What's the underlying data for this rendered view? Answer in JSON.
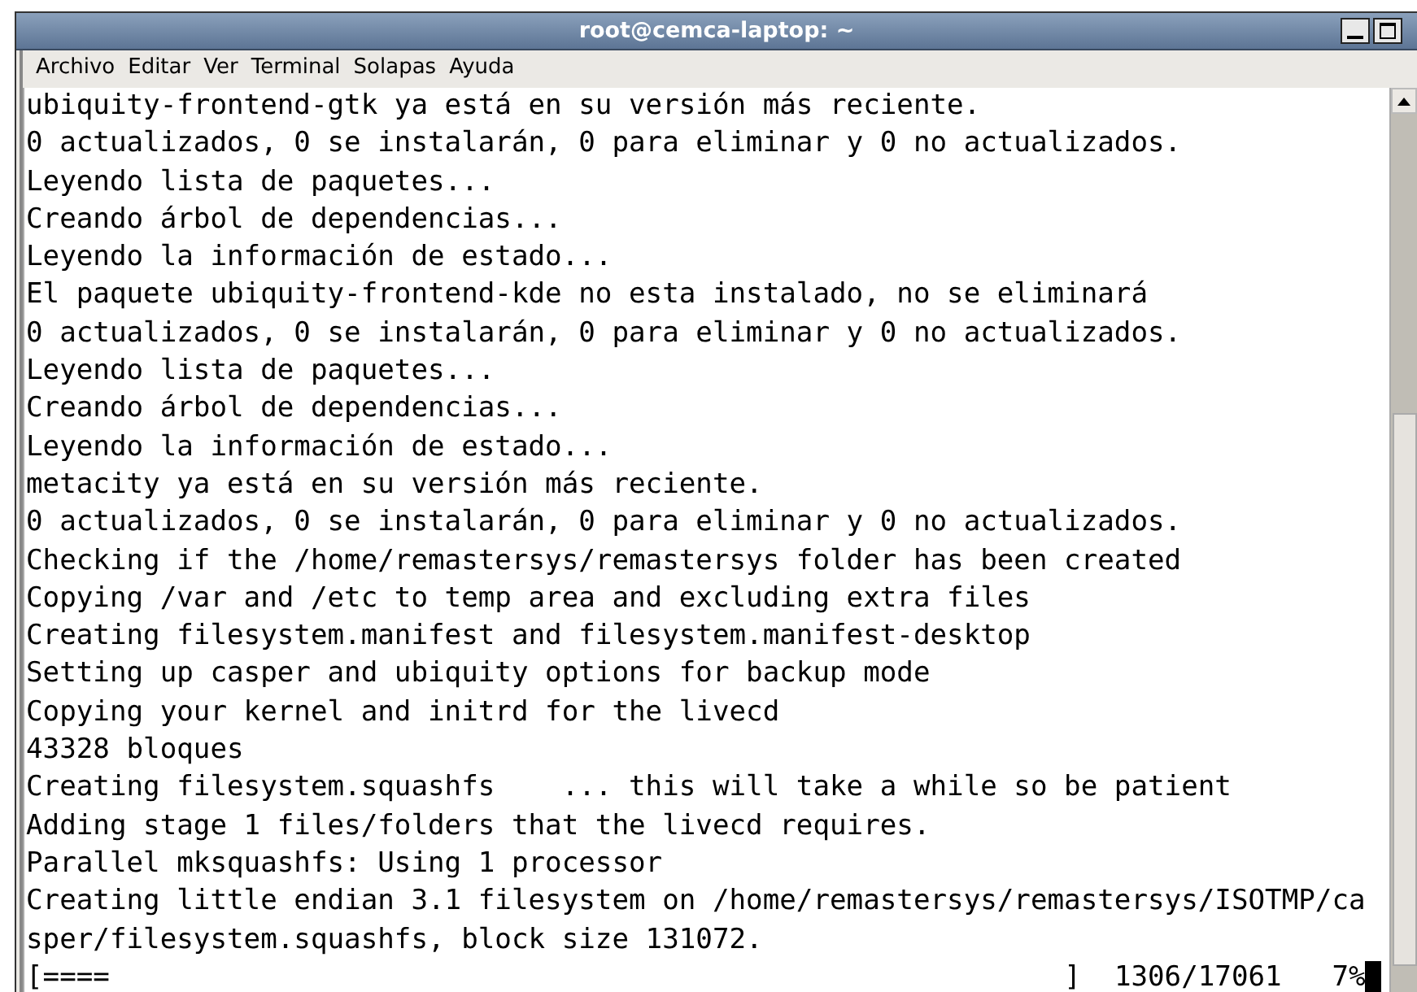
{
  "window": {
    "title": "root@cemca-laptop: ~"
  },
  "menu": [
    "Archivo",
    "Editar",
    "Ver",
    "Terminal",
    "Solapas",
    "Ayuda"
  ],
  "terminal": {
    "lines": [
      "ubiquity-frontend-gtk ya está en su versión más reciente.",
      "0 actualizados, 0 se instalarán, 0 para eliminar y 0 no actualizados.",
      "Leyendo lista de paquetes...",
      "Creando árbol de dependencias...",
      "Leyendo la información de estado...",
      "El paquete ubiquity-frontend-kde no esta instalado, no se eliminará",
      "0 actualizados, 0 se instalarán, 0 para eliminar y 0 no actualizados.",
      "Leyendo lista de paquetes...",
      "Creando árbol de dependencias...",
      "Leyendo la información de estado...",
      "metacity ya está en su versión más reciente.",
      "0 actualizados, 0 se instalarán, 0 para eliminar y 0 no actualizados.",
      "Checking if the /home/remastersys/remastersys folder has been created",
      "Copying /var and /etc to temp area and excluding extra files",
      "Creating filesystem.manifest and filesystem.manifest-desktop",
      "Setting up casper and ubiquity options for backup mode",
      "Copying your kernel and initrd for the livecd",
      "43328 bloques",
      "Creating filesystem.squashfs    ... this will take a while so be patient",
      "Adding stage 1 files/folders that the livecd requires.",
      "Parallel mksquashfs: Using 1 processor",
      "Creating little endian 3.1 filesystem on /home/remastersys/remastersys/ISOTMP/ca",
      "sper/filesystem.squashfs, block size 131072."
    ],
    "progress": {
      "bar": "[====",
      "end": "]",
      "count": "1306/17061",
      "percent": "7%"
    }
  }
}
